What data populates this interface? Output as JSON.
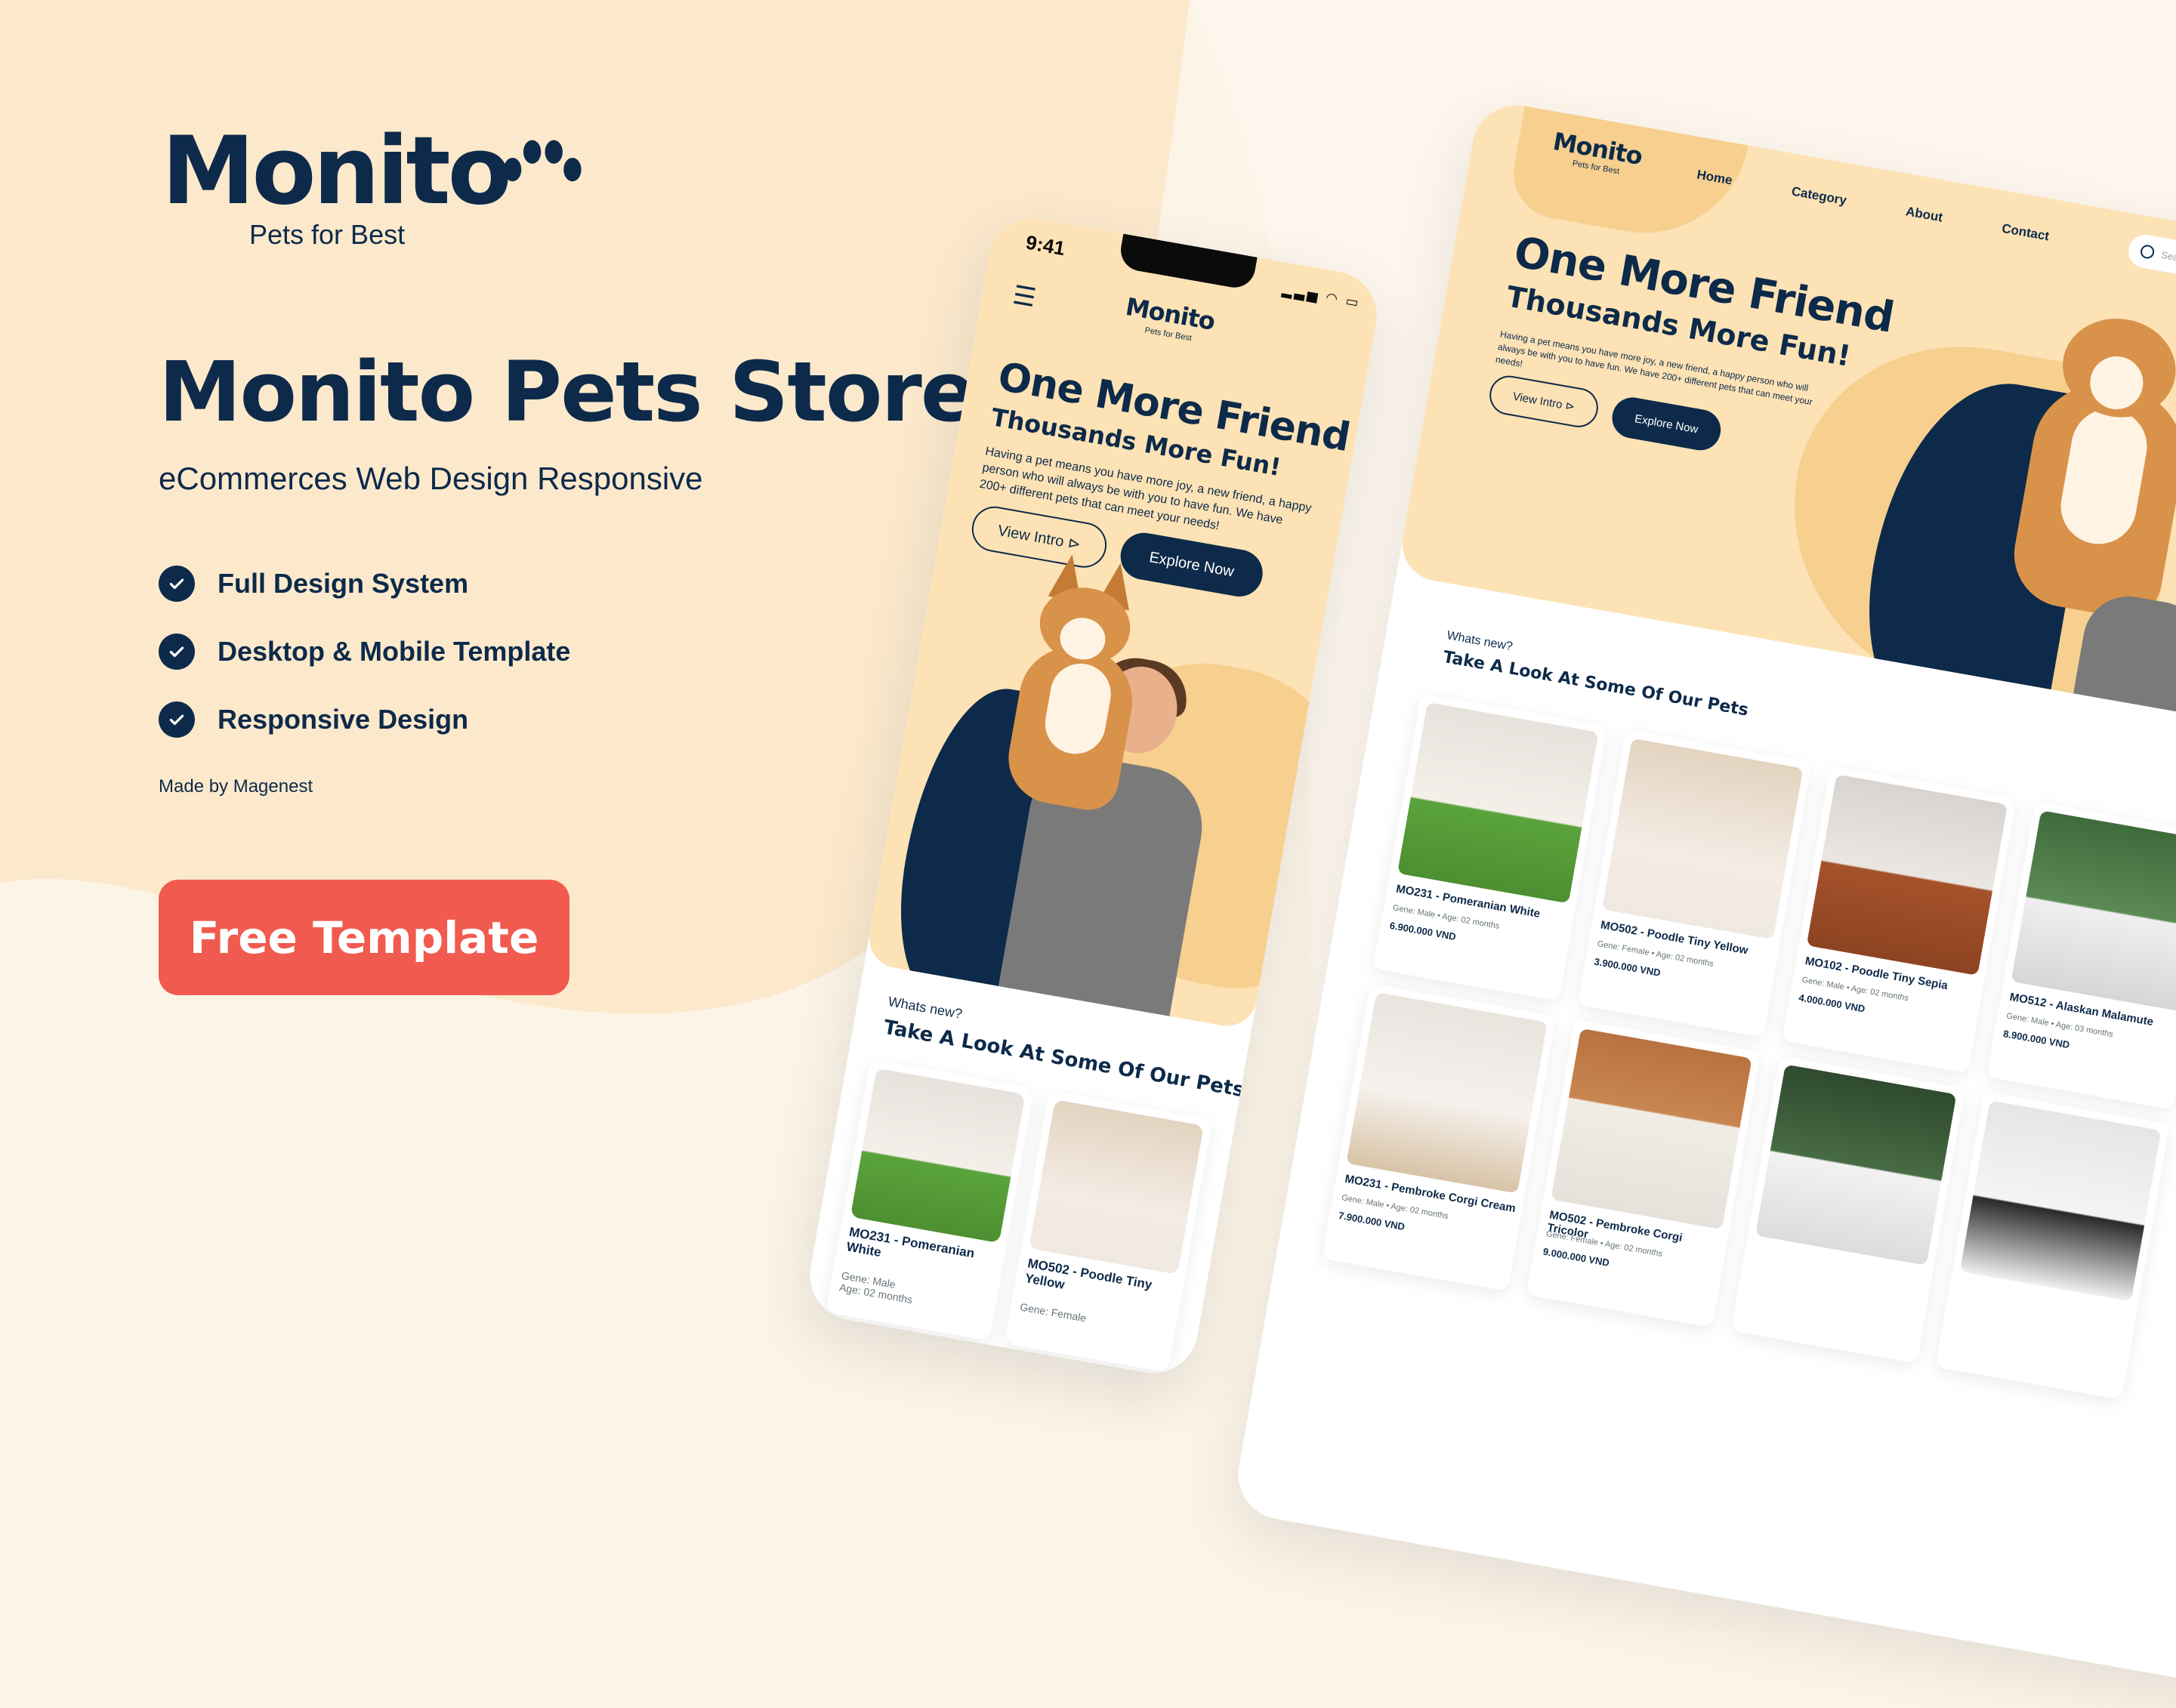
{
  "brand": {
    "logo": "Monito",
    "tagline": "Pets for Best"
  },
  "headline": "Monito Pets Store",
  "subheadline": "eCommerces Web Design Responsive",
  "features": [
    "Full Design System",
    "Desktop & Mobile Template",
    "Responsive Design"
  ],
  "made_by": "Made by Magenest",
  "cta_label": "Free Template",
  "colors": {
    "navy": "#0d2a4a",
    "cream": "#fcf4e6",
    "peach": "#fce2b5",
    "coral": "#f15a4f"
  },
  "phone": {
    "time": "9:41",
    "logo": "Monito",
    "logo_tag": "Pets for Best",
    "hero_title": "One More Friend",
    "hero_subtitle": "Thousands More Fun!",
    "hero_text": "Having a pet means you have more joy, a new friend, a happy person who will always be with you to have fun. We have 200+ different pets that can meet your needs!",
    "btn_intro": "View Intro",
    "btn_explore": "Explore Now",
    "section_kicker": "Whats new?",
    "section_title": "Take A Look At Some Of Our Pets",
    "cards": [
      {
        "name": "MO231 - Pomeranian White",
        "meta": "Gene: Male",
        "age": "Age: 02 months"
      },
      {
        "name": "MO502 - Poodle Tiny Yellow",
        "meta": "Gene: Female",
        "age": ""
      }
    ]
  },
  "desktop": {
    "logo": "Monito",
    "logo_tag": "Pets for Best",
    "nav": [
      "Home",
      "Category",
      "About",
      "Contact"
    ],
    "search_placeholder": "Search something here!",
    "hero_title": "One More Friend",
    "hero_subtitle": "Thousands More Fun!",
    "hero_text": "Having a pet means you have more joy, a new friend, a happy person who will always be with you to have fun. We have 200+ different pets that can meet your needs!",
    "btn_intro": "View Intro",
    "btn_explore": "Explore Now",
    "section_kicker": "Whats new?",
    "section_title": "Take A Look At Some Of Our Pets",
    "cards": [
      {
        "name": "MO231 - Pomeranian White",
        "meta": "Gene: Male  •  Age: 02 months",
        "price": "6.900.000 VND"
      },
      {
        "name": "MO502 - Poodle Tiny Yellow",
        "meta": "Gene: Female  •  Age: 02 months",
        "price": "3.900.000 VND"
      },
      {
        "name": "MO102 - Poodle Tiny Sepia",
        "meta": "Gene: Male  •  Age: 02 months",
        "price": "4.000.000 VND"
      },
      {
        "name": "MO512 - Alaskan Malamute",
        "meta": "Gene: Male  •  Age: 03 months",
        "price": "8.900.000 VND"
      },
      {
        "name": "MO231 - Pembroke Corgi Cream",
        "meta": "Gene: Male  •  Age: 02 months",
        "price": "7.900.000 VND"
      },
      {
        "name": "MO502 - Pembroke Corgi Tricolor",
        "meta": "Gene: Female  •  Age: 02 months",
        "price": "9.000.000 VND"
      }
    ]
  }
}
